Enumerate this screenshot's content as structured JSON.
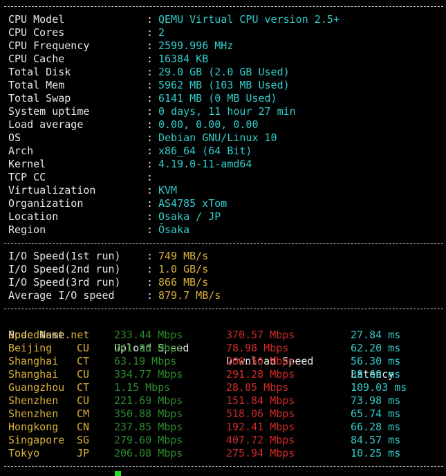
{
  "system_info": [
    {
      "key": "CPU Model",
      "value": "QEMU Virtual CPU version 2.5+"
    },
    {
      "key": "CPU Cores",
      "value": "2"
    },
    {
      "key": "CPU Frequency",
      "value": "2599.996 MHz"
    },
    {
      "key": "CPU Cache",
      "value": "16384 KB"
    },
    {
      "key": "Total Disk",
      "value": "29.0 GB (2.0 GB Used)"
    },
    {
      "key": "Total Mem",
      "value": "5962 MB (103 MB Used)"
    },
    {
      "key": "Total Swap",
      "value": "6141 MB (0 MB Used)"
    },
    {
      "key": "System uptime",
      "value": "0 days, 11 hour 27 min"
    },
    {
      "key": "Load average",
      "value": "0.00, 0.00, 0.00"
    },
    {
      "key": "OS",
      "value": "Debian GNU/Linux 10"
    },
    {
      "key": "Arch",
      "value": "x86_64 (64 Bit)"
    },
    {
      "key": "Kernel",
      "value": "4.19.0-11-amd64"
    },
    {
      "key": "TCP CC",
      "value": ""
    },
    {
      "key": "Virtualization",
      "value": "KVM"
    },
    {
      "key": "Organization",
      "value": "AS4785 xTom"
    },
    {
      "key": "Location",
      "value": "Osaka / JP"
    },
    {
      "key": "Region",
      "value": "Ōsaka"
    }
  ],
  "io_tests": [
    {
      "key": "I/O Speed(1st run)",
      "value": "749 MB/s"
    },
    {
      "key": "I/O Speed(2nd run)",
      "value": "1.0 GB/s"
    },
    {
      "key": "I/O Speed(3rd run)",
      "value": "866 MB/s"
    },
    {
      "key": "Average I/O speed",
      "value": "879.7 MB/s"
    }
  ],
  "speed_table": {
    "headers": {
      "node": "Node Name",
      "upload": "Upload Speed",
      "download": "Download Speed",
      "latency": "Latency"
    },
    "rows": [
      {
        "node": "Speedtest.net",
        "isp": "",
        "upload": "233.44 Mbps",
        "download": "370.57 Mbps",
        "latency": "27.84 ms"
      },
      {
        "node": "Beijing",
        "isp": "CU",
        "upload": "241.86 Mbps",
        "download": "78.98 Mbps",
        "latency": "62.20 ms"
      },
      {
        "node": "Shanghai",
        "isp": "CT",
        "upload": "63.19 Mbps",
        "download": "200.56 Mbps",
        "latency": "56.30 ms"
      },
      {
        "node": "Shanghai",
        "isp": "CU",
        "upload": "334.77 Mbps",
        "download": "291.28 Mbps",
        "latency": "38.69 ms"
      },
      {
        "node": "Guangzhou",
        "isp": "CT",
        "upload": "1.15 Mbps",
        "download": "28.05 Mbps",
        "latency": "109.03 ms"
      },
      {
        "node": "Shenzhen",
        "isp": "CU",
        "upload": "221.69 Mbps",
        "download": "151.84 Mbps",
        "latency": "73.98 ms"
      },
      {
        "node": "Shenzhen",
        "isp": "CM",
        "upload": "350.88 Mbps",
        "download": "518.06 Mbps",
        "latency": "65.74 ms"
      },
      {
        "node": "Hongkong",
        "isp": "CN",
        "upload": "237.85 Mbps",
        "download": "192.41 Mbps",
        "latency": "66.28 ms"
      },
      {
        "node": "Singapore",
        "isp": "SG",
        "upload": "279.60 Mbps",
        "download": "407.72 Mbps",
        "latency": "84.57 ms"
      },
      {
        "node": "Tokyo",
        "isp": "JP",
        "upload": "206.08 Mbps",
        "download": "275.94 Mbps",
        "latency": "10.25 ms"
      }
    ]
  },
  "colors": {
    "background": "#000000",
    "value_cyan": "#33cccc",
    "io_yellow": "#d9b13b",
    "upload_green": "#2d8a2d",
    "download_red": "#d12a2a",
    "cursor_green": "#22dd22"
  }
}
